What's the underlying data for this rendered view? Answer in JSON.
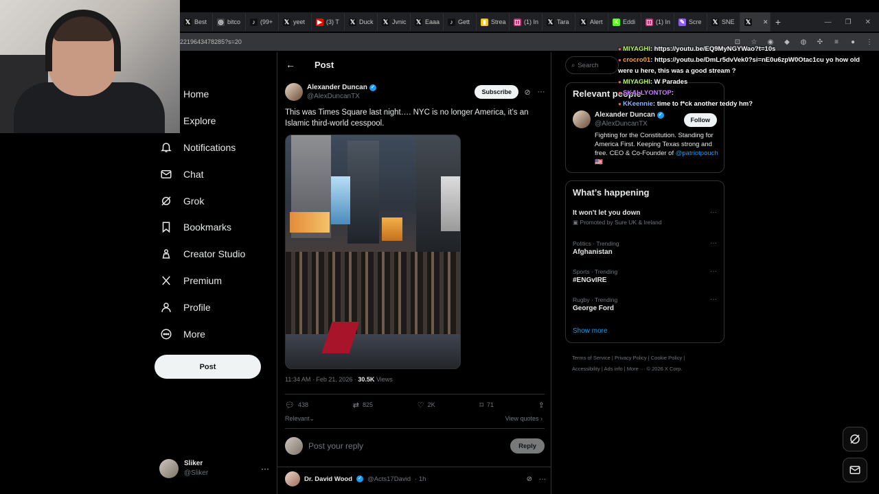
{
  "browser": {
    "tabs": [
      {
        "label": "Best",
        "icon": "x-icon",
        "color": "#111111"
      },
      {
        "label": "bitco",
        "icon": "chrome-icon",
        "color": "#444444"
      },
      {
        "label": "(99+",
        "icon": "tiktok-icon",
        "color": "#111111"
      },
      {
        "label": "yeet",
        "icon": "x-icon",
        "color": "#111111"
      },
      {
        "label": "(3) T",
        "icon": "youtube-icon",
        "color": "#ff0000"
      },
      {
        "label": "Duck",
        "icon": "x-icon",
        "color": "#111111"
      },
      {
        "label": "Jvnic",
        "icon": "x-icon",
        "color": "#111111"
      },
      {
        "label": "Eaaa",
        "icon": "x-icon",
        "color": "#111111"
      },
      {
        "label": "Gett",
        "icon": "tiktok-icon",
        "color": "#111111"
      },
      {
        "label": "Strea",
        "icon": "chart-icon",
        "color": "#f5c518"
      },
      {
        "label": "(1) In",
        "icon": "instagram-icon",
        "color": "#d62976"
      },
      {
        "label": "Tara",
        "icon": "x-icon",
        "color": "#111111"
      },
      {
        "label": "Alert",
        "icon": "x-icon",
        "color": "#111111"
      },
      {
        "label": "Eddi",
        "icon": "kick-icon",
        "color": "#53fc18"
      },
      {
        "label": "(1) In",
        "icon": "instagram-icon",
        "color": "#d62976"
      },
      {
        "label": "Scre",
        "icon": "pen-icon",
        "color": "#8a5cf6"
      },
      {
        "label": "SNE",
        "icon": "x-icon",
        "color": "#111111"
      },
      {
        "label": "",
        "icon": "x-icon",
        "color": "#111111",
        "active": true
      }
    ],
    "url": "2219643478285?s=20"
  },
  "nav": {
    "items": [
      {
        "label": "Home",
        "icon": "home-icon"
      },
      {
        "label": "Explore",
        "icon": "search-icon"
      },
      {
        "label": "Notifications",
        "icon": "bell-icon"
      },
      {
        "label": "Chat",
        "icon": "mail-icon"
      },
      {
        "label": "Grok",
        "icon": "grok-icon"
      },
      {
        "label": "Bookmarks",
        "icon": "bookmark-icon"
      },
      {
        "label": "Creator Studio",
        "icon": "creator-studio-icon"
      },
      {
        "label": "Premium",
        "icon": "x-logo-icon"
      },
      {
        "label": "Profile",
        "icon": "person-icon"
      },
      {
        "label": "More",
        "icon": "more-circle-icon"
      }
    ],
    "post_label": "Post",
    "account": {
      "name": "Sliker",
      "handle": "@Sliker",
      "more": "···"
    }
  },
  "post": {
    "header": "Post",
    "back": "←",
    "author_name": "Alexander Duncan",
    "author_handle": "@AlexDuncanTX",
    "subscribe": "Subscribe",
    "text": "This was Times Square last night…. NYC is no longer America, it’s an Islamic third-world cesspool.",
    "timestamp": "11:34 AM · Feb 21, 2026 · ",
    "views": "30.5K",
    "views_label": " Views",
    "replies": "438",
    "reposts": "825",
    "likes": "2K",
    "bookmarks": "71",
    "sort": "Relevant",
    "view_quotes": "View quotes ›",
    "reply_placeholder": "Post your reply",
    "reply_button": "Reply"
  },
  "next_reply": {
    "name": "Dr. David Wood",
    "handle": "@Acts17David",
    "time": "· 1h"
  },
  "sidebar": {
    "search_placeholder": "Search",
    "relevant_title": "Relevant people",
    "person": {
      "name": "Alexander Duncan",
      "handle": "@AlexDuncanTX",
      "follow": "Follow",
      "bio": "Fighting for the Constitution. Standing for America First. Keeping Texas strong and free. CEO & Co-Founder of ",
      "bio_link": "@patriotpouch",
      "flag": " 🇺🇸"
    },
    "happening_title": "What’s happening",
    "trends": [
      {
        "context": "",
        "name": "It won't let you down",
        "sub": "Promoted by Sure UK & Ireland"
      },
      {
        "context": "Politics · Trending",
        "name": "Afghanistan",
        "sub": ""
      },
      {
        "context": "Sports · Trending",
        "name": "#ENGvIRE",
        "sub": ""
      },
      {
        "context": "Rugby · Trending",
        "name": "George Ford",
        "sub": ""
      }
    ],
    "show_more": "Show more",
    "footer_line1": "Terms of Service  |  Privacy Policy  |  Cookie Policy  |",
    "footer_line2": "Accessibility  |  Ads info  |  More ···  © 2026 X Corp."
  },
  "chat": [
    {
      "user": "MIYAGHI",
      "msg": ": https://youtu.be/EQ9MyNGYWao?t=10s"
    },
    {
      "user": "crocro01",
      "msg": ": https://youtu.be/DmLr5dvVek0?si=nE0u6zpW0Otac1cu yo how old"
    },
    {
      "user": "",
      "msg": "were u here, this was a good stream ?"
    },
    {
      "user": "MIYAGHI",
      "msg": ":  W  Parades"
    },
    {
      "user": "SKALLYONTOP",
      "msg": ":"
    },
    {
      "user": "KKeennie",
      "msg": ": time to f*ck another teddy hm?"
    }
  ]
}
